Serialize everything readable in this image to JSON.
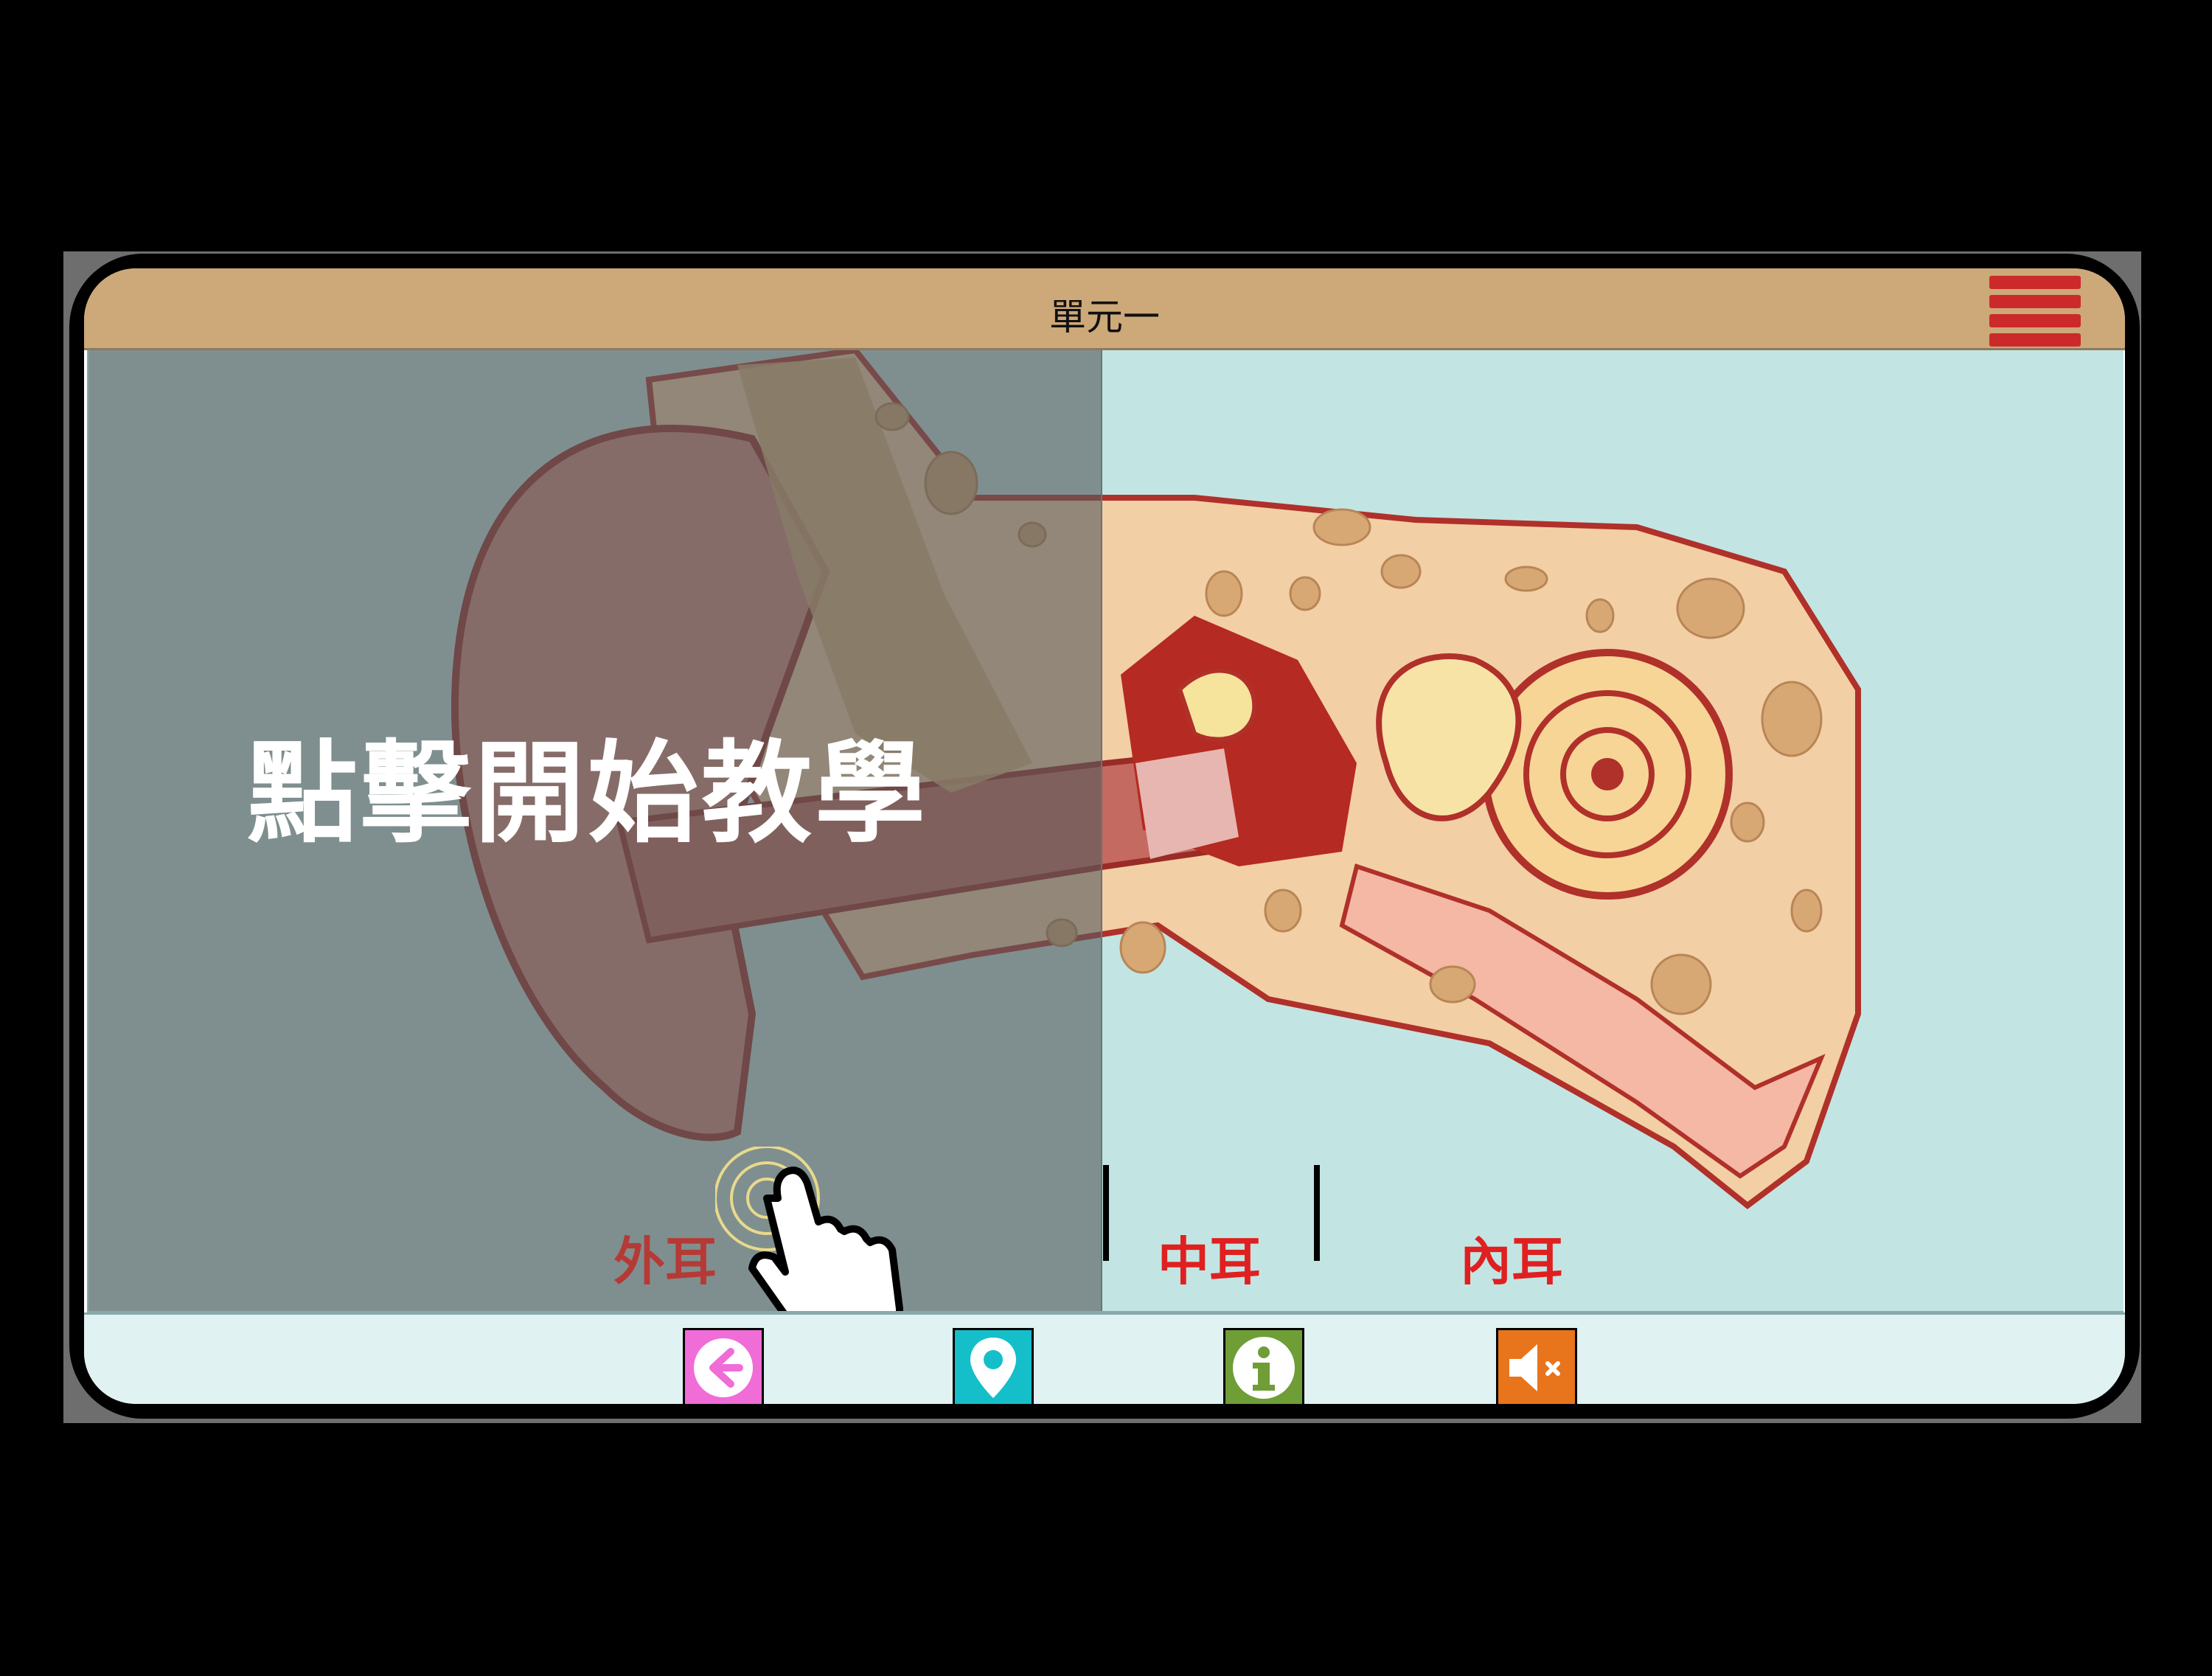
{
  "header": {
    "title": "單元一"
  },
  "overlay": {
    "headline": "點擊開始教學"
  },
  "labels": {
    "outer_ear": "外耳",
    "middle_ear": "中耳",
    "inner_ear": "內耳"
  },
  "toolbar": {
    "buttons": [
      {
        "name": "back",
        "icon": "arrow-left-icon",
        "color": "#f06cd6"
      },
      {
        "name": "map",
        "icon": "location-pin-icon",
        "color": "#14bfc9"
      },
      {
        "name": "info",
        "icon": "info-icon",
        "color": "#6f9d36"
      },
      {
        "name": "sound",
        "icon": "speaker-muted-icon",
        "color": "#e8741c"
      }
    ]
  },
  "colors": {
    "title_bar": "#cda878",
    "content_bg": "#c2e5e3",
    "menu": "#cc2a2a",
    "label_outer": "#b53a36",
    "label_red": "#e02020"
  }
}
